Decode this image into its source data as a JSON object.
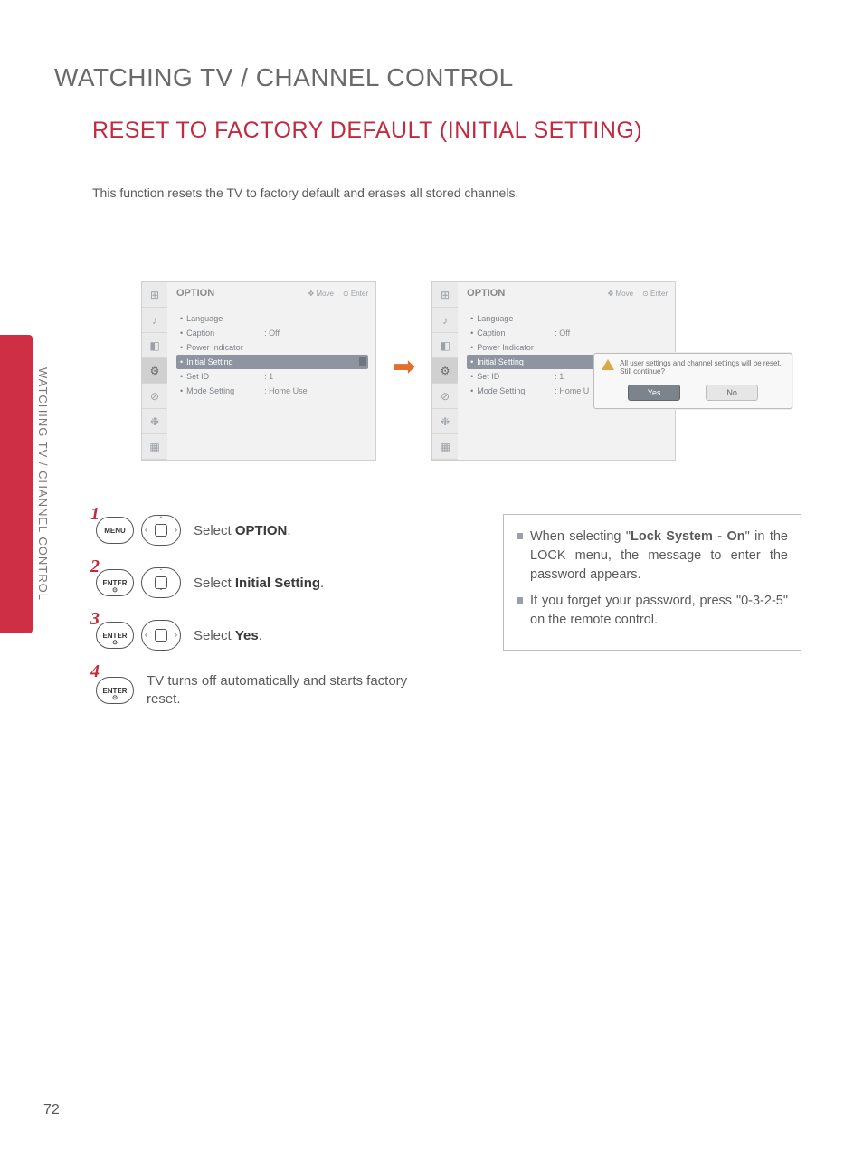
{
  "sideLabel": "WATCHING TV / CHANNEL CONTROL",
  "heading": "WATCHING TV / CHANNEL CONTROL",
  "subHeading": "RESET TO FACTORY DEFAULT (INITIAL SETTING)",
  "intro": "This function resets the TV to factory default and erases all stored channels.",
  "menu": {
    "title": "OPTION",
    "hintMove": "Move",
    "hintEnter": "Enter",
    "items": [
      {
        "label": "Language",
        "value": ""
      },
      {
        "label": "Caption",
        "value": ": Off"
      },
      {
        "label": "Power Indicator",
        "value": ""
      },
      {
        "label": "Initial Setting",
        "value": "",
        "selected": true
      },
      {
        "label": "Set ID",
        "value": ": 1"
      },
      {
        "label": "Mode Setting",
        "value": ": Home Use"
      }
    ],
    "items2valMode": ": Home U"
  },
  "dialog": {
    "text": "All user settings and channel settings will be reset, Still continue?",
    "yes": "Yes",
    "no": "No"
  },
  "steps": {
    "s1": {
      "key": "MENU",
      "textPre": "Select ",
      "bold": "OPTION",
      "textPost": "."
    },
    "s2": {
      "key": "ENTER",
      "textPre": "Select ",
      "bold": "Initial Setting",
      "textPost": "."
    },
    "s3": {
      "key": "ENTER",
      "textPre": "Select ",
      "bold": "Yes",
      "textPost": "."
    },
    "s4": {
      "key": "ENTER",
      "text": "TV turns off automatically and starts factory reset."
    }
  },
  "info": {
    "line1a": "When selecting \"",
    "line1bold": "Lock System - On",
    "line1b": "\" in the LOCK menu, the message to enter the password appears.",
    "line2": "If you forget your password, press \"0-3-2-5\" on the remote control."
  },
  "pageNumber": "72"
}
